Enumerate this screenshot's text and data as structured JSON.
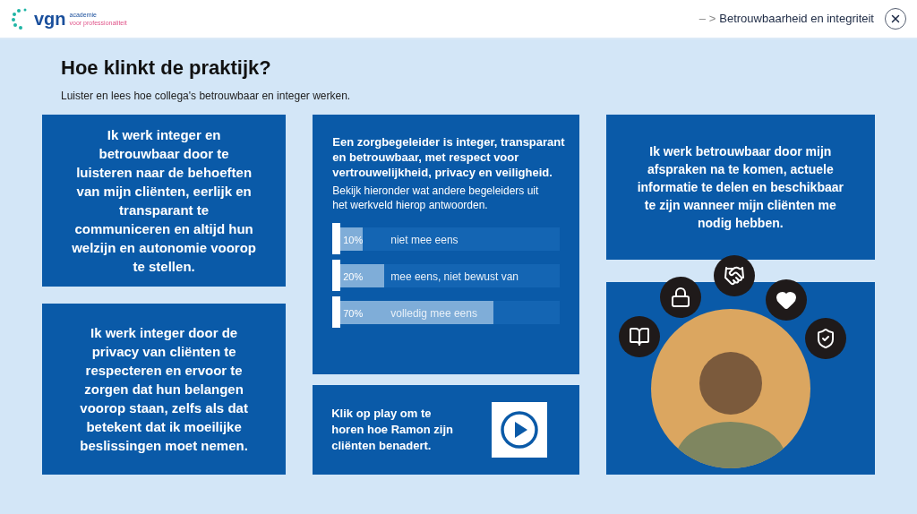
{
  "header": {
    "logo": {
      "name": "vgn",
      "tagline_1": "academie",
      "tagline_2": "voor professionaliteit"
    },
    "breadcrumb_prefix": "– >",
    "breadcrumb": "Betrouwbaarheid en integriteit"
  },
  "page": {
    "title": "Hoe klinkt de praktijk?",
    "subtitle": "Luister en lees hoe collega's betrouwbaar en integer werken."
  },
  "quotes_left": [
    "Ik werk integer en betrouwbaar door te luisteren naar de behoeften van mijn cliënten, eerlijk en transparant te communiceren en altijd hun welzijn en autonomie voorop te stellen.",
    "Ik werk integer door de privacy van cliënten te respecteren en ervoor te zorgen dat hun belangen voorop staan, zelfs als dat betekent dat ik moeilijke beslissingen moet nemen."
  ],
  "poll": {
    "statement": "Een zorgbegeleider is integer, transparant en betrouwbaar, met respect voor vertrouwelijkheid, privacy en veiligheid.",
    "intro": "Bekijk hieronder wat andere begeleiders uit het werkveld hierop antwoorden.",
    "results": [
      {
        "percent": "10%",
        "label": "niet mee eens",
        "level": 0.1
      },
      {
        "percent": "20%",
        "label": "mee eens, niet bewust van",
        "level": 0.2
      },
      {
        "percent": "70%",
        "label": "volledig mee eens",
        "level": 0.7
      }
    ]
  },
  "audio": {
    "text": "Klik op play om te horen hoe Ramon zijn cliënten benadert."
  },
  "quote_right": "Ik werk betrouwbaar door mijn afspraken na te komen, actuele informatie te delen en beschikbaar te zijn wanneer mijn cliënten me nodig hebben."
}
